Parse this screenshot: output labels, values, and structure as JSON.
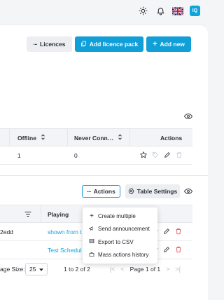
{
  "header": {
    "theme_icon": "sun-icon",
    "notifications_icon": "bell-icon",
    "language_flag": "uk-flag-icon",
    "avatar_initials": "IQ"
  },
  "toolbar": {
    "licences_label": "Licences",
    "add_licence_pack_label": "Add licence pack",
    "add_new_label": "Add new"
  },
  "stats_table": {
    "columns": [
      "Offline",
      "Never Conn…",
      "Actions"
    ],
    "row": {
      "offline": "1",
      "never_connected": "0"
    }
  },
  "players_toolbar": {
    "actions_label": "Actions",
    "table_settings_label": "Table Settings"
  },
  "players_table": {
    "columns": [
      "Playing"
    ],
    "rows": [
      {
        "name_fragment": "2edd",
        "playing": "shown from t"
      },
      {
        "name_fragment": "",
        "playing": "Test Schedul"
      }
    ]
  },
  "pagination": {
    "page_size_label": "age Size:",
    "page_size_value": "25",
    "range_label": "1 to 2 of 2",
    "page_label": "Page 1 of 1"
  },
  "actions_menu": {
    "items": [
      "Create multiple",
      "Send announcement",
      "Export to CSV",
      "Mass actions history"
    ]
  },
  "colors": {
    "accent": "#119fd8",
    "danger": "#e5484d"
  }
}
